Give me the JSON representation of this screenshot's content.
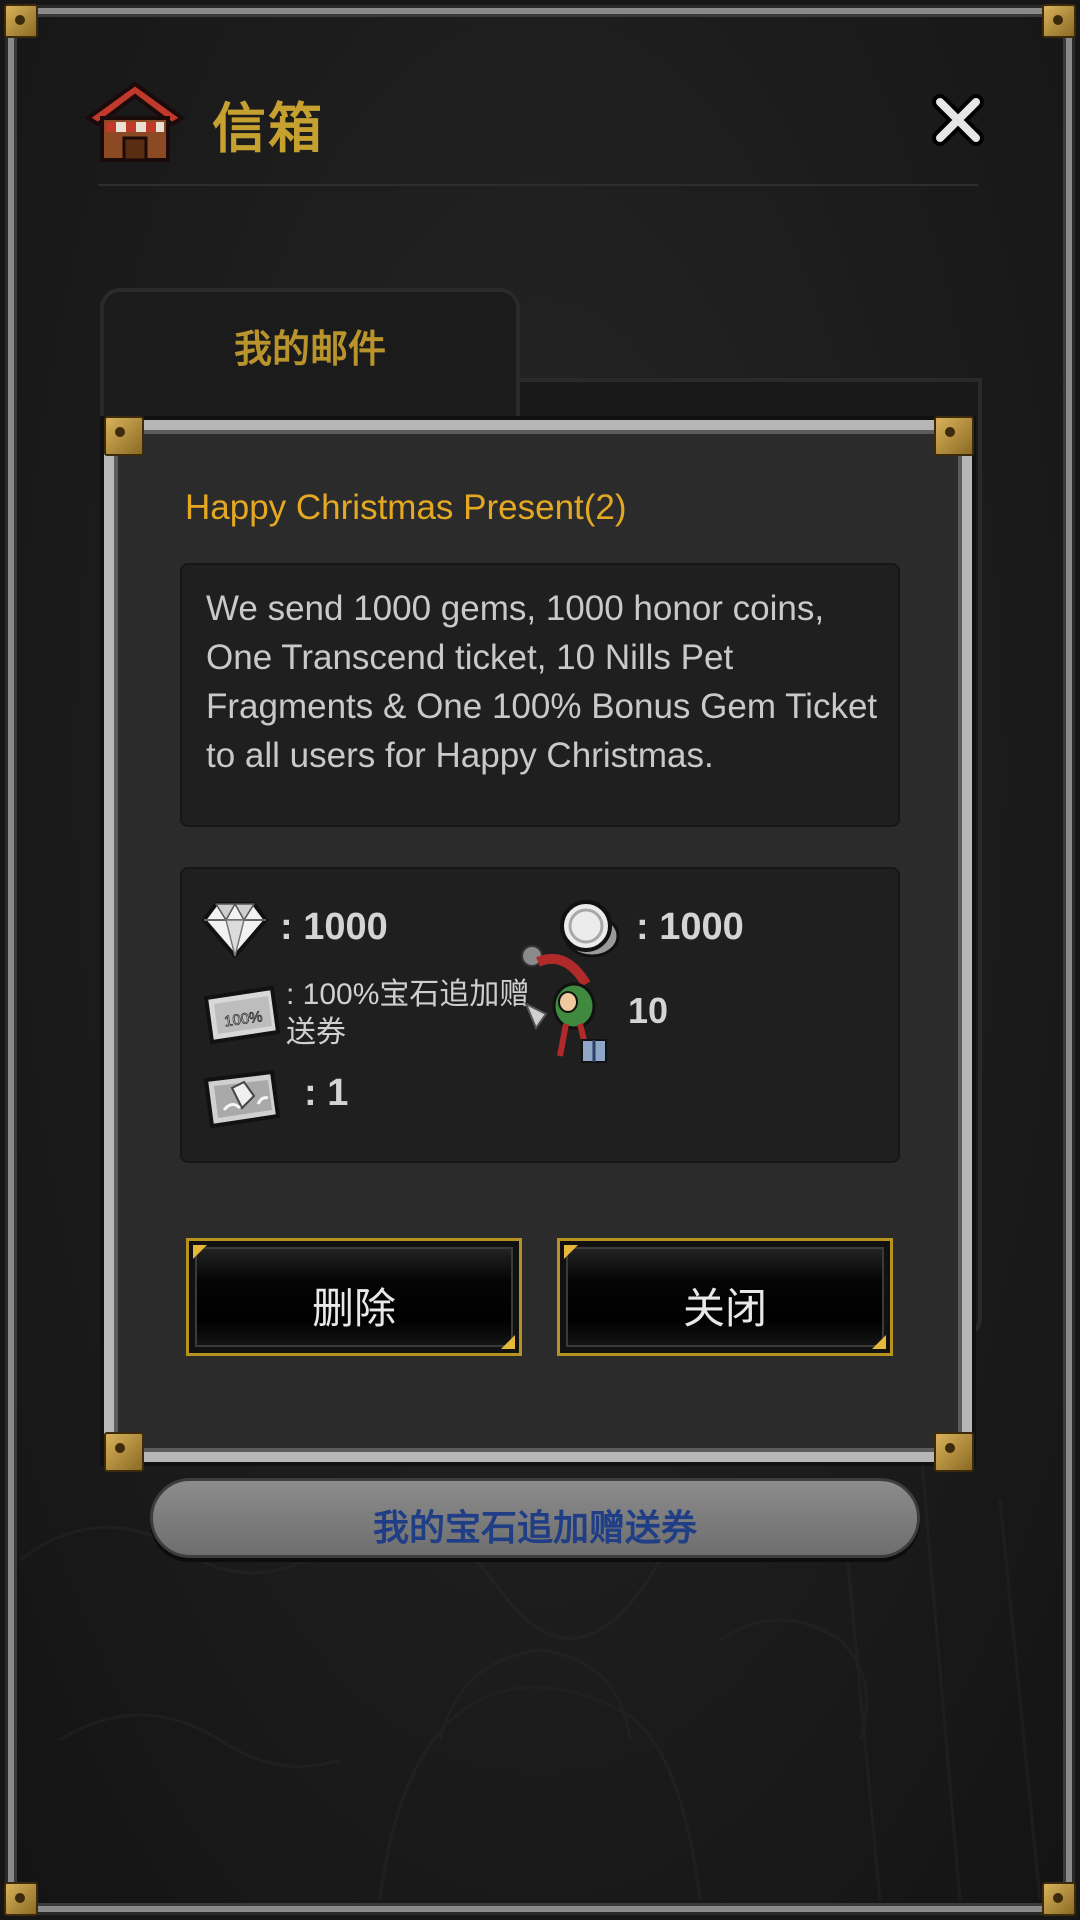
{
  "header": {
    "title": "信箱",
    "icon": "mail-house-icon",
    "close_icon": "close-icon"
  },
  "tabs": [
    {
      "label": "我的邮件",
      "active": true
    }
  ],
  "mail": {
    "title": "Happy Christmas Present(2)",
    "message": "We send 1000 gems, 1000 honor coins, One Transcend ticket, 10 Nills Pet Fragments & One 100% Bonus Gem Ticket to all users for Happy Christmas.",
    "rewards": [
      {
        "icon": "gem-icon",
        "text": ": 1000"
      },
      {
        "icon": "honor-coin-icon",
        "text": ": 1000"
      },
      {
        "icon": "bonus-gem-ticket-icon",
        "text": ": 100%宝石追加赠送券"
      },
      {
        "icon": "nills-pet-icon",
        "text": "10"
      },
      {
        "icon": "transcend-ticket-icon",
        "text": ": 1"
      }
    ],
    "delete_label": "删除",
    "close_label": "关闭"
  },
  "footer": {
    "gem_ticket_button_label": "我的宝石追加赠送券"
  },
  "colors": {
    "title_gold": "#c7a130",
    "mail_title": "#e4a822",
    "button_border": "#b8921f",
    "footer_text": "#1f3e86"
  }
}
